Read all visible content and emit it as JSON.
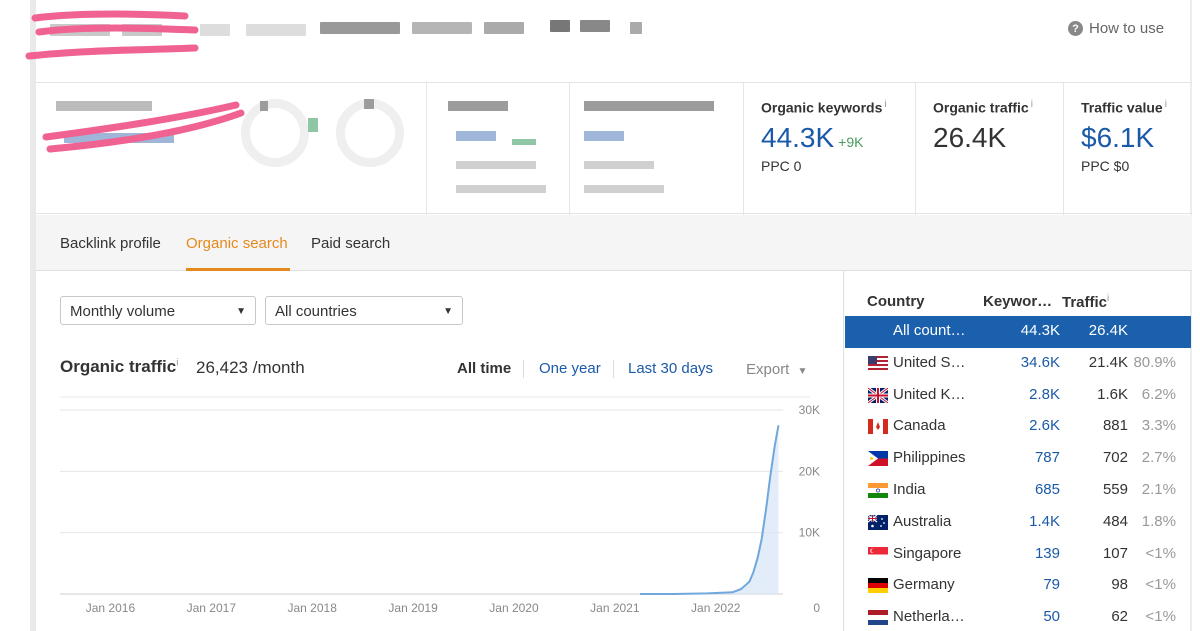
{
  "header": {
    "help_label": "How to use"
  },
  "metrics": [
    {
      "label": "Organic keywords",
      "value": "44.3K",
      "delta": "+9K",
      "sub": "PPC 0",
      "style": "blue"
    },
    {
      "label": "Organic traffic",
      "value": "26.4K",
      "delta": "",
      "sub": "",
      "style": "dark"
    },
    {
      "label": "Traffic value",
      "value": "$6.1K",
      "delta": "",
      "sub": "PPC $0",
      "style": "blue"
    }
  ],
  "info_mark": "i",
  "tabs": [
    "Backlink profile",
    "Organic search",
    "Paid search"
  ],
  "active_tab": 1,
  "filters": {
    "volume": "Monthly volume",
    "country": "All countries"
  },
  "traffic": {
    "title": "Organic traffic",
    "value": "26,423 /month"
  },
  "ranges": [
    "All time",
    "One year",
    "Last 30 days"
  ],
  "export_label": "Export",
  "chart_data": {
    "type": "area",
    "title": "",
    "xlabel": "",
    "ylabel": "",
    "x_tick_labels": [
      "Jan 2016",
      "Jan 2017",
      "Jan 2018",
      "Jan 2019",
      "Jan 2020",
      "Jan 2021",
      "Jan 2022"
    ],
    "y_tick_labels": [
      "30K",
      "20K",
      "10K",
      "0"
    ],
    "ylim": [
      0,
      30000
    ],
    "xlim": [
      "2015-07",
      "2022-09"
    ],
    "grid": true,
    "series": [
      {
        "color": "#6fa8dc",
        "x": [
          "2021-04",
          "2021-08",
          "2021-12",
          "2022-03",
          "2022-04",
          "2022-05",
          "2022-05-15",
          "2022-06",
          "2022-06-15",
          "2022-07",
          "2022-07-15",
          "2022-08",
          "2022-08-15"
        ],
        "y": [
          0,
          0,
          100,
          300,
          800,
          2000,
          3500,
          6000,
          9000,
          14000,
          19000,
          24000,
          27500
        ]
      }
    ]
  },
  "countries": {
    "headers": {
      "country": "Country",
      "keywords": "Keywor…",
      "traffic": "Traffic"
    },
    "rows": [
      {
        "flag": "none",
        "name": "All count…",
        "keywords": "44.3K",
        "traffic": "26.4K",
        "pct": ""
      },
      {
        "flag": "us",
        "name": "United S…",
        "keywords": "34.6K",
        "traffic": "21.4K",
        "pct": "80.9%"
      },
      {
        "flag": "gb",
        "name": "United K…",
        "keywords": "2.8K",
        "traffic": "1.6K",
        "pct": "6.2%"
      },
      {
        "flag": "ca",
        "name": "Canada",
        "keywords": "2.6K",
        "traffic": "881",
        "pct": "3.3%"
      },
      {
        "flag": "ph",
        "name": "Philippines",
        "keywords": "787",
        "traffic": "702",
        "pct": "2.7%"
      },
      {
        "flag": "in",
        "name": "India",
        "keywords": "685",
        "traffic": "559",
        "pct": "2.1%"
      },
      {
        "flag": "au",
        "name": "Australia",
        "keywords": "1.4K",
        "traffic": "484",
        "pct": "1.8%"
      },
      {
        "flag": "sg",
        "name": "Singapore",
        "keywords": "139",
        "traffic": "107",
        "pct": "<1%"
      },
      {
        "flag": "de",
        "name": "Germany",
        "keywords": "79",
        "traffic": "98",
        "pct": "<1%"
      },
      {
        "flag": "nl",
        "name": "Netherla…",
        "keywords": "50",
        "traffic": "62",
        "pct": "<1%"
      }
    ]
  },
  "colors": {
    "accent_orange": "#e5891e",
    "link_blue": "#1a5aa8",
    "selected_row": "#1b60ad",
    "delta_green": "#4a9b5f"
  }
}
